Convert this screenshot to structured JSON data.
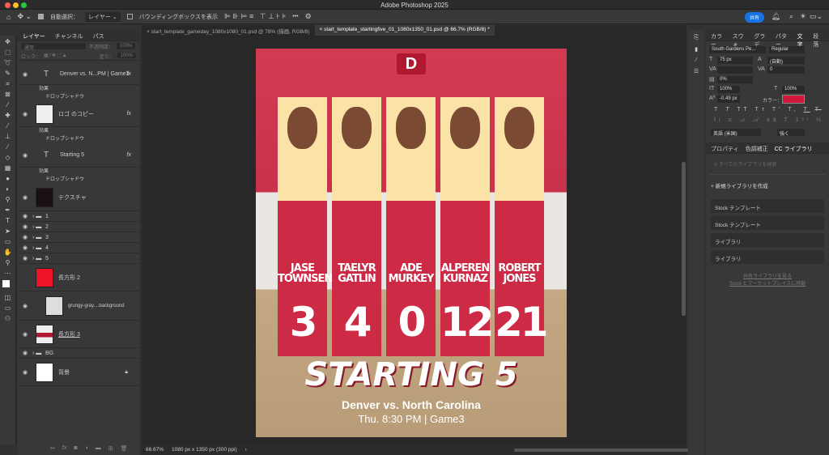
{
  "app": {
    "title": "Adobe Photoshop 2025"
  },
  "options": {
    "auto_select": "自動選択：",
    "auto_select_value": "レイヤー",
    "bbox": "バウンディングボックスを表示",
    "more": "•••",
    "share": "共有"
  },
  "tabs": [
    {
      "label": "start_template_gameday_1080x1080_01.psd @ 78% (描画, RGB/8)"
    },
    {
      "label": "start_template_startingfive_01_1080x1350_01.psd @ 66.7% (RGB/8) *"
    }
  ],
  "layers_panel": {
    "tabs": [
      "レイヤー",
      "チャンネル",
      "パス"
    ],
    "blend": "通常",
    "opacity_label": "不透明度：",
    "opacity": "100%",
    "lock_label": "ロック：",
    "fill_label": "塗り：",
    "fill": "100%",
    "effects": "効果",
    "drop_shadow": "ドロップシャドウ",
    "fx": "fx",
    "layers": [
      "Denver vs. N...PM | Game3",
      "ロゴ のコピー",
      "Starting 5",
      "テクスチャ",
      "1",
      "2",
      "3",
      "4",
      "5",
      "長方形 2",
      "grungy-gray....background",
      "長方形 3",
      "BG",
      "背景"
    ]
  },
  "status": {
    "zoom": "66.67%",
    "doc_size": "1080 px x 1350 px (300 ppi)"
  },
  "poster": {
    "logo": "D",
    "players": [
      {
        "first": "JASE",
        "last": "TOWNSEND",
        "number": "3"
      },
      {
        "first": "TAELYR",
        "last": "GATLIN",
        "number": "4"
      },
      {
        "first": "ADE",
        "last": "MURKEY",
        "number": "0"
      },
      {
        "first": "ALPEREN",
        "last": "KURNAZ",
        "number": "12"
      },
      {
        "first": "ROBERT",
        "last": "JONES",
        "number": "21"
      }
    ],
    "title": "STARTING 5",
    "matchup": "Denver vs. North Carolina",
    "time": "Thu. 8:30 PM | Game3"
  },
  "character": {
    "tabs": [
      "カラー",
      "スウォ",
      "グラデ",
      "パター",
      "文字",
      "段落"
    ],
    "font": "South Gardens Pe...",
    "style": "Regular",
    "size": "75 px",
    "leading": "(自動)",
    "tracking": "0",
    "scale_pct": "0%",
    "vscale": "100%",
    "hscale": "100%",
    "baseline": "-0.49 px",
    "color_label": "カラー：",
    "color": "#d0183a",
    "language": "英語 (米国)",
    "aa": "強く"
  },
  "library": {
    "tabs": [
      "プロパティ",
      "色調補正",
      "CC ライブラリ"
    ],
    "search_placeholder": "すべてのライブラリを検索",
    "create": "新規ライブラリを作成",
    "items": [
      "Stock テンプレート",
      "Stock テンプレート",
      "ライブラリ",
      "ライブラリ"
    ],
    "link1": "共有ライブラリを見る",
    "link2": "Stock とマーケットプレイスに移動"
  }
}
